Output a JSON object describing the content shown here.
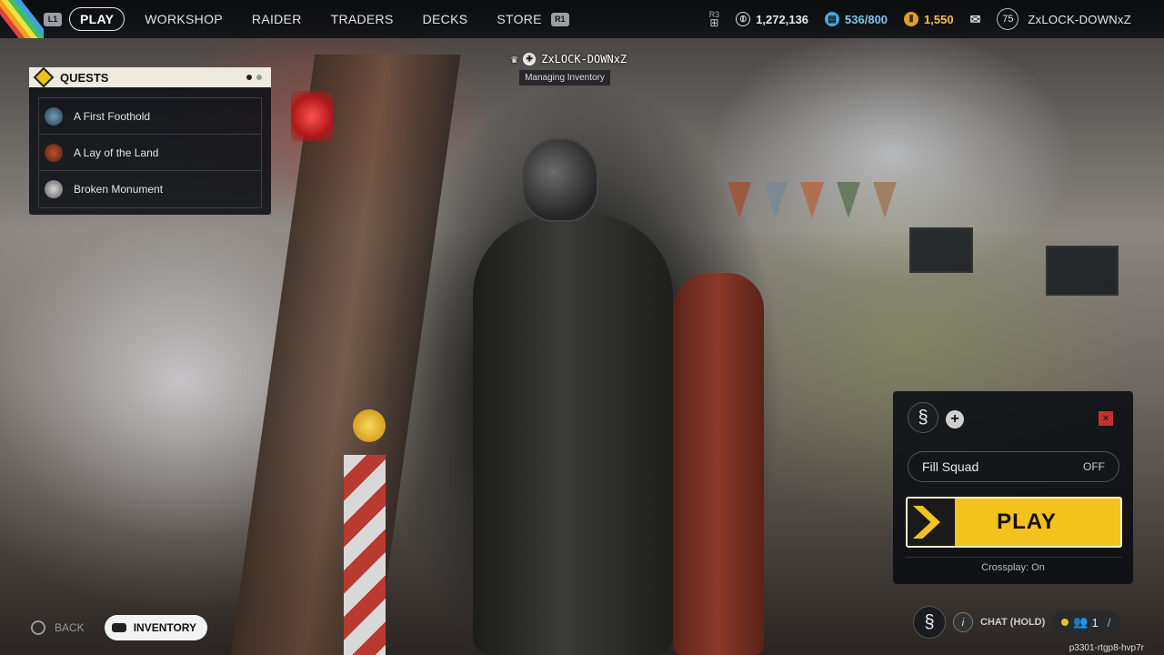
{
  "nav": {
    "left_bumper": "L1",
    "right_bumper": "R1",
    "items": [
      {
        "label": "PLAY",
        "active": true
      },
      {
        "label": "WORKSHOP"
      },
      {
        "label": "RAIDER"
      },
      {
        "label": "TRADERS"
      },
      {
        "label": "DECKS"
      },
      {
        "label": "STORE"
      }
    ]
  },
  "currencies": {
    "r3_hint": "R3",
    "coins": "1,272,136",
    "stash": "536/800",
    "tokens": "1,550"
  },
  "player": {
    "level": "75",
    "username": "ZxLOCK-DOWNxZ",
    "status": "Managing Inventory"
  },
  "quests": {
    "title": "QUESTS",
    "items": [
      {
        "label": "A First Foothold"
      },
      {
        "label": "A Lay of the Land"
      },
      {
        "label": "Broken Monument"
      }
    ]
  },
  "squad": {
    "fill_label": "Fill Squad",
    "fill_state": "OFF",
    "play_label": "PLAY",
    "crossplay": "Crossplay: On"
  },
  "bottom": {
    "back": "BACK",
    "inventory": "INVENTORY",
    "chat": "CHAT (HOLD)",
    "party_count": "1",
    "session_id": "p3301-rtgp8-hvp7r"
  },
  "colors": {
    "accent_yellow": "#f4c21c",
    "panel_bg": "#0e1016",
    "stash_blue": "#4aa8d8"
  }
}
